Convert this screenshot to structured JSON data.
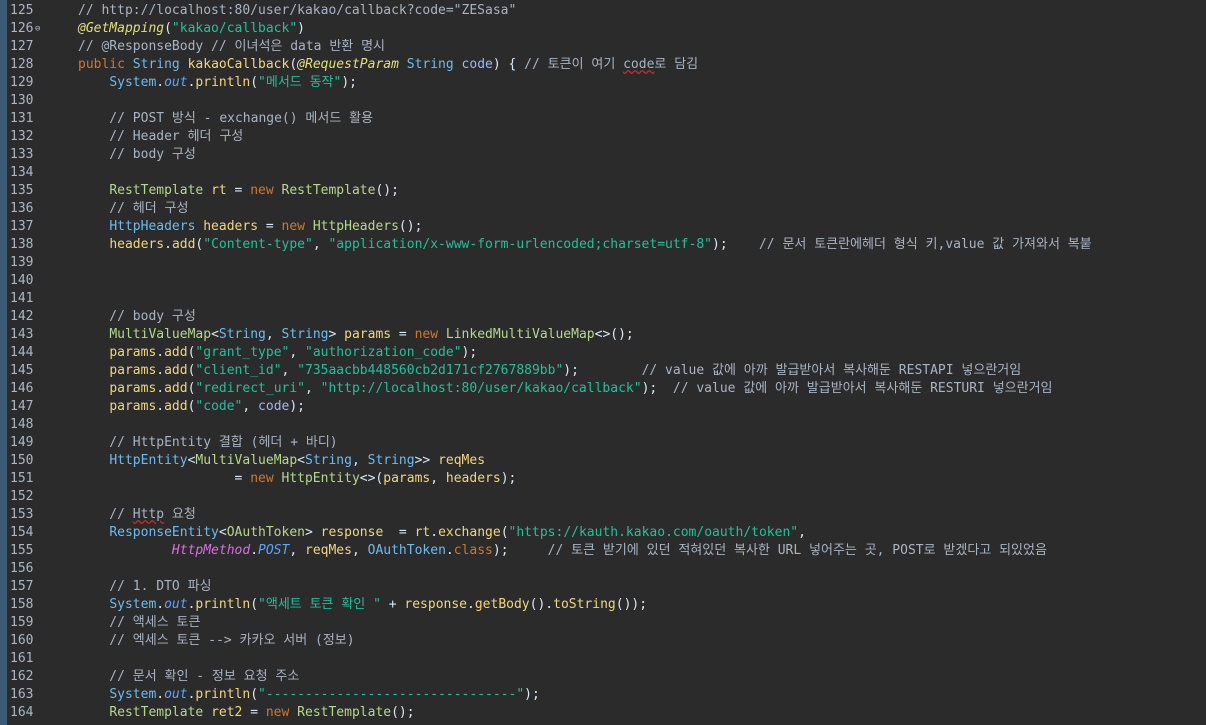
{
  "editor": {
    "lines": [
      {
        "n": "125",
        "tokens": [
          [
            "comment",
            "// http://localhost:80/user/kakao/callback?code=\"ZESasa\""
          ]
        ]
      },
      {
        "n": "126",
        "fold": "⊖",
        "tokens": [
          [
            "annot",
            "@GetMapping"
          ],
          [
            "default",
            "("
          ],
          [
            "string",
            "\"kakao/callback\""
          ],
          [
            "default",
            ")"
          ]
        ]
      },
      {
        "n": "127",
        "tokens": [
          [
            "comment",
            "// @ResponseBody // 이녀석은 data 반환 명시"
          ]
        ]
      },
      {
        "n": "128",
        "tokens": [
          [
            "keyword",
            "public "
          ],
          [
            "type",
            "String "
          ],
          [
            "method",
            "kakaoCallback"
          ],
          [
            "default",
            "("
          ],
          [
            "annot",
            "@RequestParam "
          ],
          [
            "type",
            "String "
          ],
          [
            "param",
            "code"
          ],
          [
            "default",
            ") { "
          ],
          [
            "comment",
            "// 토큰이 여기 "
          ],
          [
            "comment-underline",
            "code"
          ],
          [
            "comment",
            "로 담김"
          ]
        ]
      },
      {
        "n": "129",
        "tokens": [
          [
            "default",
            "    "
          ],
          [
            "type",
            "System"
          ],
          [
            "default",
            "."
          ],
          [
            "static",
            "out"
          ],
          [
            "default",
            "."
          ],
          [
            "method",
            "println"
          ],
          [
            "default",
            "("
          ],
          [
            "string",
            "\"메서드 동작\""
          ],
          [
            "default",
            ");"
          ]
        ]
      },
      {
        "n": "130",
        "tokens": []
      },
      {
        "n": "131",
        "tokens": [
          [
            "comment",
            "    // POST 방식 - exchange() 메서드 활용"
          ]
        ]
      },
      {
        "n": "132",
        "tokens": [
          [
            "comment",
            "    // Header 헤더 구성"
          ]
        ]
      },
      {
        "n": "133",
        "tokens": [
          [
            "comment",
            "    // body 구성"
          ]
        ]
      },
      {
        "n": "134",
        "tokens": []
      },
      {
        "n": "135",
        "tokens": [
          [
            "default",
            "    "
          ],
          [
            "type2",
            "RestTemplate "
          ],
          [
            "method",
            "rt"
          ],
          [
            "default",
            " = "
          ],
          [
            "keyword",
            "new "
          ],
          [
            "type2",
            "RestTemplate"
          ],
          [
            "default",
            "();"
          ]
        ]
      },
      {
        "n": "136",
        "tokens": [
          [
            "comment",
            "    // 헤더 구성"
          ]
        ]
      },
      {
        "n": "137",
        "tokens": [
          [
            "default",
            "    "
          ],
          [
            "type",
            "HttpHeaders "
          ],
          [
            "method",
            "headers"
          ],
          [
            "default",
            " = "
          ],
          [
            "keyword",
            "new "
          ],
          [
            "type2",
            "HttpHeaders"
          ],
          [
            "default",
            "();"
          ]
        ]
      },
      {
        "n": "138",
        "tokens": [
          [
            "default",
            "    "
          ],
          [
            "method",
            "headers"
          ],
          [
            "default",
            "."
          ],
          [
            "method",
            "add"
          ],
          [
            "default",
            "("
          ],
          [
            "string",
            "\"Content-type\""
          ],
          [
            "default",
            ", "
          ],
          [
            "string",
            "\"application/x-www-form-urlencoded;charset=utf-8\""
          ],
          [
            "default",
            ");    "
          ],
          [
            "comment",
            "// 문서 토큰란에헤더 형식 키,value 값 가져와서 복붙"
          ]
        ]
      },
      {
        "n": "139",
        "tokens": []
      },
      {
        "n": "140",
        "tokens": []
      },
      {
        "n": "141",
        "tokens": []
      },
      {
        "n": "142",
        "tokens": [
          [
            "comment",
            "    // body 구성"
          ]
        ]
      },
      {
        "n": "143",
        "tokens": [
          [
            "default",
            "    "
          ],
          [
            "type2",
            "MultiValueMap"
          ],
          [
            "default",
            "<"
          ],
          [
            "type",
            "String"
          ],
          [
            "default",
            ", "
          ],
          [
            "type",
            "String"
          ],
          [
            "default",
            "> "
          ],
          [
            "method",
            "params"
          ],
          [
            "default",
            " = "
          ],
          [
            "keyword",
            "new "
          ],
          [
            "type2",
            "LinkedMultiValueMap"
          ],
          [
            "default",
            "<>();"
          ]
        ]
      },
      {
        "n": "144",
        "tokens": [
          [
            "default",
            "    "
          ],
          [
            "method",
            "params"
          ],
          [
            "default",
            "."
          ],
          [
            "method",
            "add"
          ],
          [
            "default",
            "("
          ],
          [
            "string",
            "\"grant_type\""
          ],
          [
            "default",
            ", "
          ],
          [
            "string",
            "\"authorization_code\""
          ],
          [
            "default",
            ");"
          ]
        ]
      },
      {
        "n": "145",
        "tokens": [
          [
            "default",
            "    "
          ],
          [
            "method",
            "params"
          ],
          [
            "default",
            "."
          ],
          [
            "method",
            "add"
          ],
          [
            "default",
            "("
          ],
          [
            "string",
            "\"client_id\""
          ],
          [
            "default",
            ", "
          ],
          [
            "string",
            "\"735aacbb448560cb2d171cf2767889bb\""
          ],
          [
            "default",
            ");        "
          ],
          [
            "comment",
            "// value 값에 아까 발급받아서 복사해둔 RESTAPI 넣으란거임"
          ]
        ]
      },
      {
        "n": "146",
        "tokens": [
          [
            "default",
            "    "
          ],
          [
            "method",
            "params"
          ],
          [
            "default",
            "."
          ],
          [
            "method",
            "add"
          ],
          [
            "default",
            "("
          ],
          [
            "string",
            "\"redirect_uri\""
          ],
          [
            "default",
            ", "
          ],
          [
            "string",
            "\"http://localhost:80/user/kakao/callback\""
          ],
          [
            "default",
            ");  "
          ],
          [
            "comment",
            "// value 값에 아까 발급받아서 복사해둔 RESTURI 넣으란거임"
          ]
        ]
      },
      {
        "n": "147",
        "tokens": [
          [
            "default",
            "    "
          ],
          [
            "method",
            "params"
          ],
          [
            "default",
            "."
          ],
          [
            "method",
            "add"
          ],
          [
            "default",
            "("
          ],
          [
            "string",
            "\"code\""
          ],
          [
            "default",
            ", "
          ],
          [
            "param",
            "code"
          ],
          [
            "default",
            ");"
          ]
        ]
      },
      {
        "n": "148",
        "tokens": []
      },
      {
        "n": "149",
        "tokens": [
          [
            "comment",
            "    // HttpEntity 결합 (헤더 + 바디)"
          ]
        ]
      },
      {
        "n": "150",
        "tokens": [
          [
            "default",
            "    "
          ],
          [
            "type",
            "HttpEntity"
          ],
          [
            "default",
            "<"
          ],
          [
            "type2",
            "MultiValueMap"
          ],
          [
            "default",
            "<"
          ],
          [
            "type",
            "String"
          ],
          [
            "default",
            ", "
          ],
          [
            "type",
            "String"
          ],
          [
            "default",
            ">> "
          ],
          [
            "method",
            "reqMes"
          ]
        ]
      },
      {
        "n": "151",
        "tokens": [
          [
            "default",
            "                    = "
          ],
          [
            "keyword",
            "new "
          ],
          [
            "type2",
            "HttpEntity"
          ],
          [
            "default",
            "<>("
          ],
          [
            "method",
            "params"
          ],
          [
            "default",
            ", "
          ],
          [
            "method",
            "headers"
          ],
          [
            "default",
            ");"
          ]
        ]
      },
      {
        "n": "152",
        "tokens": []
      },
      {
        "n": "153",
        "tokens": [
          [
            "comment",
            "    // "
          ],
          [
            "comment-underline",
            "Http"
          ],
          [
            "comment",
            " 요청"
          ]
        ]
      },
      {
        "n": "154",
        "tokens": [
          [
            "default",
            "    "
          ],
          [
            "type",
            "ResponseEntity"
          ],
          [
            "default",
            "<"
          ],
          [
            "type2",
            "OAuthToken"
          ],
          [
            "default",
            "> "
          ],
          [
            "method",
            "response"
          ],
          [
            "default",
            "  = "
          ],
          [
            "method",
            "rt"
          ],
          [
            "default",
            "."
          ],
          [
            "method",
            "exchange"
          ],
          [
            "default",
            "("
          ],
          [
            "string",
            "\"https://kauth.kakao.com/oauth/token\""
          ],
          [
            "default",
            ","
          ]
        ]
      },
      {
        "n": "155",
        "tokens": [
          [
            "default",
            "            "
          ],
          [
            "italic-type",
            "HttpMethod"
          ],
          [
            "default",
            "."
          ],
          [
            "static",
            "POST"
          ],
          [
            "default",
            ", "
          ],
          [
            "method",
            "reqMes"
          ],
          [
            "default",
            ", "
          ],
          [
            "type",
            "OAuthToken"
          ],
          [
            "default",
            "."
          ],
          [
            "keyword",
            "class"
          ],
          [
            "default",
            ");     "
          ],
          [
            "comment",
            "// 토큰 받기에 있던 적혀있던 복사한 URL 넣어주는 곳, POST로 받겠다고 되있었음"
          ]
        ]
      },
      {
        "n": "156",
        "tokens": []
      },
      {
        "n": "157",
        "tokens": [
          [
            "comment",
            "    // 1. DTO 파싱"
          ]
        ]
      },
      {
        "n": "158",
        "tokens": [
          [
            "default",
            "    "
          ],
          [
            "type",
            "System"
          ],
          [
            "default",
            "."
          ],
          [
            "static",
            "out"
          ],
          [
            "default",
            "."
          ],
          [
            "method",
            "println"
          ],
          [
            "default",
            "("
          ],
          [
            "string",
            "\"액세트 토큰 확인 \""
          ],
          [
            "default",
            " + "
          ],
          [
            "method",
            "response"
          ],
          [
            "default",
            "."
          ],
          [
            "method",
            "getBody"
          ],
          [
            "default",
            "()."
          ],
          [
            "method",
            "toString"
          ],
          [
            "default",
            "());"
          ]
        ]
      },
      {
        "n": "159",
        "tokens": [
          [
            "comment",
            "    // 액세스 토큰"
          ]
        ]
      },
      {
        "n": "160",
        "tokens": [
          [
            "comment",
            "    // 엑세스 토큰 --> 카카오 서버 (정보)"
          ]
        ]
      },
      {
        "n": "161",
        "tokens": []
      },
      {
        "n": "162",
        "tokens": [
          [
            "comment",
            "    // 문서 확인 - 정보 요청 주소"
          ]
        ]
      },
      {
        "n": "163",
        "tokens": [
          [
            "default",
            "    "
          ],
          [
            "type",
            "System"
          ],
          [
            "default",
            "."
          ],
          [
            "static",
            "out"
          ],
          [
            "default",
            "."
          ],
          [
            "method",
            "println"
          ],
          [
            "default",
            "("
          ],
          [
            "string",
            "\"--------------------------------\""
          ],
          [
            "default",
            ");"
          ]
        ]
      },
      {
        "n": "164",
        "tokens": [
          [
            "default",
            "    "
          ],
          [
            "type2",
            "RestTemplate "
          ],
          [
            "method",
            "ret2"
          ],
          [
            "default",
            " = "
          ],
          [
            "keyword",
            "new "
          ],
          [
            "type2",
            "RestTemplate"
          ],
          [
            "default",
            "();"
          ]
        ]
      }
    ]
  }
}
